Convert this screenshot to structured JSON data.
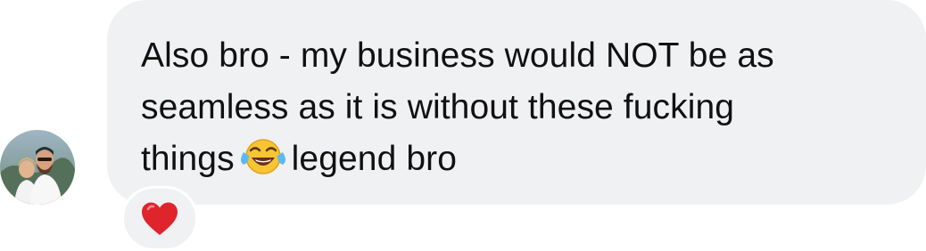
{
  "message": {
    "line1": "Also bro - my business would NOT be as",
    "line2": "seamless as it is without these fucking",
    "line3_before": "things",
    "line3_after": "legend bro",
    "inline_emoji": "face-with-tears-of-joy-icon"
  },
  "reaction": {
    "icon": "red-heart-icon",
    "color": "#e0242c"
  },
  "avatar": {
    "icon": "sender-avatar"
  },
  "colors": {
    "bubble": "#f0f1f3",
    "text": "#111111"
  }
}
